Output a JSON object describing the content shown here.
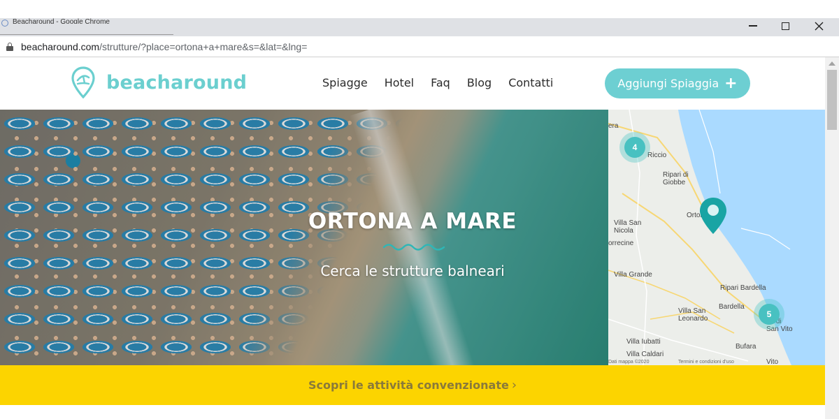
{
  "browser": {
    "tab_title": "Beacharound - Google Chrome",
    "url_host": "beacharound.com",
    "url_path": "/strutture/?place=ortona+a+mare&s=&lat=&lng="
  },
  "header": {
    "logo_text": "beacharound",
    "nav": [
      "Spiagge",
      "Hotel",
      "Faq",
      "Blog",
      "Contatti"
    ],
    "cta_label": "Aggiungi Spiaggia",
    "cta_icon": "plus-icon"
  },
  "hero": {
    "title": "ORTONA A MARE",
    "subtitle": "Cerca le strutture balneari"
  },
  "map": {
    "labels": {
      "riccio": "Riccio",
      "ripari_giobbe": "Ripari di\nGiobbe",
      "ortona": "Ortona",
      "villa_san_nicola": "Villa San\nNicola",
      "torrecine": "orrecine",
      "villa_grande": "Villa Grande",
      "ripari_bardella": "Ripari Bardella",
      "bardella": "Bardella",
      "villa_san_leonardo": "Villa San\nLeonardo",
      "san_vito": "na di\nSan Vito",
      "bufara": "Bufara",
      "villa_iubatti": "Villa Iubatti",
      "villa_caldari": "Villa Caldari",
      "era": "era",
      "map_data": "Dati mappa ©2020",
      "terms": "Termini e condizioni d'uso",
      "vito": "Vito"
    },
    "clusters": [
      {
        "count": "4"
      },
      {
        "count": "5"
      }
    ],
    "accent": "#19a4a4"
  },
  "promo": {
    "text": "Scopri le attività convenzionate",
    "arrow": "›",
    "background": "#fcd400"
  },
  "colors": {
    "brand": "#6bcfcf",
    "cta": "#6dcfd2"
  }
}
